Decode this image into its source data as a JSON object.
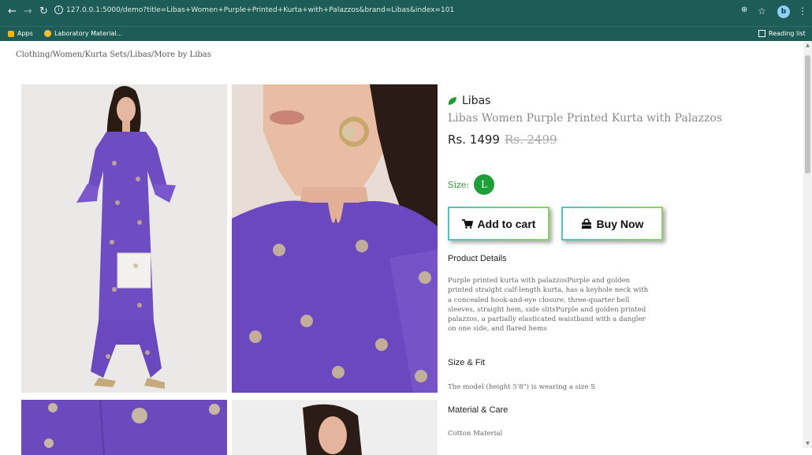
{
  "browser": {
    "url": "127.0.0.1:5000/demo?title=Libas+Women+Purple+Printed+Kurta+with+Palazzos&brand=Libas&index=101",
    "bookmarks": [
      {
        "label": "Apps",
        "icon": "apps-grid-icon"
      },
      {
        "label": "Laboratory Material...",
        "icon": "bookmark-favicon-icon"
      }
    ],
    "reading_list": "Reading list",
    "profile_initial": "b"
  },
  "breadcrumb": "Clothing/Women/Kurta Sets/Libas/More by Libas",
  "product": {
    "brand": "Libas",
    "title": "Libas Women Purple Printed Kurta with Palazzos",
    "price": "Rs. 1499",
    "mrp": "Rs. 2499",
    "size_label": "Size:",
    "size_value": "L",
    "add_to_cart": "Add to cart",
    "buy_now": "Buy Now",
    "details_heading": "Product Details",
    "details_text": "Purple printed kurta with palazzosPurple and golden printed straight calf-length kurta, has a keyhole neck with a concealed hook-and-eye closure, three-quarter bell sleeves, straight hem, side slitsPurple and golden printed palazzos, a partially elasticated waistband with a dangler on one side, and flared hems",
    "size_fit_heading": "Size & Fit",
    "size_fit_text": "The model (height 5'8\") is wearing a size S",
    "material_heading": "Material & Care",
    "material_text": "Cotton Material"
  },
  "colors": {
    "chrome": "#1d5c57",
    "kurta_purple": "#6d4bbf",
    "size_green": "#1e9e37",
    "button_border": "#4fc3c1"
  }
}
